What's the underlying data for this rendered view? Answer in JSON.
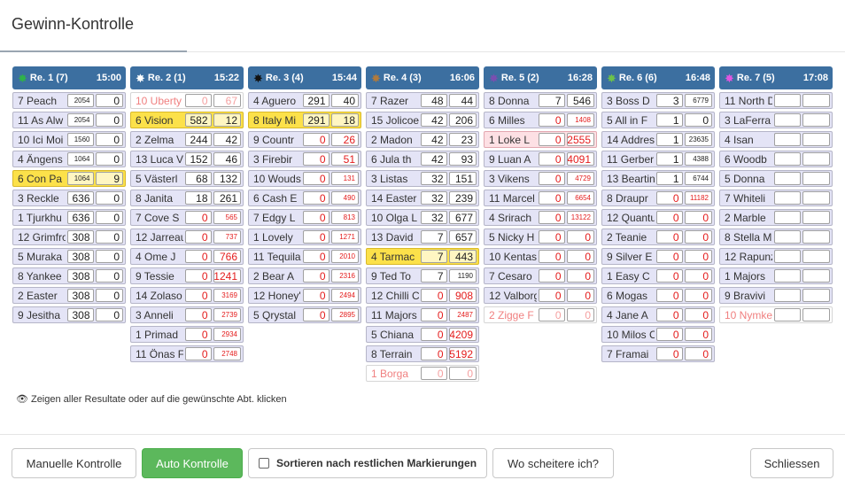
{
  "modal": {
    "title": "Gewinn-Kontrolle"
  },
  "races": [
    {
      "name": "Re. 1 (7)",
      "time": "15:00",
      "color": "#2fb24a",
      "rows": [
        {
          "name": "7 Peach",
          "a": "2054",
          "b": "0",
          "style": "n"
        },
        {
          "name": "11 As Alw",
          "a": "2054",
          "b": "0",
          "style": "n"
        },
        {
          "name": "10 Ici Moi",
          "a": "1560",
          "b": "0",
          "style": "n"
        },
        {
          "name": "4 Ängens",
          "a": "1064",
          "b": "0",
          "style": "n"
        },
        {
          "name": "6 Con Pa",
          "a": "1064",
          "b": "9",
          "style": "hl"
        },
        {
          "name": "3 Reckle",
          "a": "636",
          "b": "0",
          "style": "n"
        },
        {
          "name": "1 Tjurkhu",
          "a": "636",
          "b": "0",
          "style": "n"
        },
        {
          "name": "12 Grimfro",
          "a": "308",
          "b": "0",
          "style": "n"
        },
        {
          "name": "5 Muraka",
          "a": "308",
          "b": "0",
          "style": "n"
        },
        {
          "name": "8 Yankee",
          "a": "308",
          "b": "0",
          "style": "n"
        },
        {
          "name": "2 Easter",
          "a": "308",
          "b": "0",
          "style": "n"
        },
        {
          "name": "9 Jesitha",
          "a": "308",
          "b": "0",
          "style": "n"
        }
      ]
    },
    {
      "name": "Re. 2 (1)",
      "time": "15:22",
      "color": "#ffffff",
      "rows": [
        {
          "name": "10 Uberty",
          "a": "0",
          "b": "67",
          "style": "dim"
        },
        {
          "name": "6 Vision",
          "a": "582",
          "b": "12",
          "style": "hl"
        },
        {
          "name": "2 Zelma",
          "a": "244",
          "b": "42",
          "style": "n"
        },
        {
          "name": "13 Luca V",
          "a": "152",
          "b": "46",
          "style": "n"
        },
        {
          "name": "5 Västerl",
          "a": "68",
          "b": "132",
          "style": "n"
        },
        {
          "name": "8 Janita",
          "a": "18",
          "b": "261",
          "style": "n"
        },
        {
          "name": "7 Cove S",
          "a": "0",
          "b": "565",
          "style": "n"
        },
        {
          "name": "12 Jarreau",
          "a": "0",
          "b": "737",
          "style": "n"
        },
        {
          "name": "4 Ome J",
          "a": "0",
          "b": "766",
          "style": "n"
        },
        {
          "name": "9 Tessie",
          "a": "0",
          "b": "1241",
          "style": "n"
        },
        {
          "name": "14 Zolaso",
          "a": "0",
          "b": "3169",
          "style": "n"
        },
        {
          "name": "3 Anneli",
          "a": "0",
          "b": "2739",
          "style": "n"
        },
        {
          "name": "1 Primad",
          "a": "0",
          "b": "2934",
          "style": "n"
        },
        {
          "name": "11 Önas F",
          "a": "0",
          "b": "2748",
          "style": "n"
        }
      ]
    },
    {
      "name": "Re. 3 (4)",
      "time": "15:44",
      "color": "#111111",
      "rows": [
        {
          "name": "4 Aguero",
          "a": "291",
          "b": "40",
          "style": "n"
        },
        {
          "name": "8 Italy Mi",
          "a": "291",
          "b": "18",
          "style": "hl"
        },
        {
          "name": "9 Countr",
          "a": "0",
          "b": "26",
          "style": "n"
        },
        {
          "name": "3 Firebir",
          "a": "0",
          "b": "51",
          "style": "n"
        },
        {
          "name": "10 Wouds",
          "a": "0",
          "b": "131",
          "style": "n"
        },
        {
          "name": "6 Cash E",
          "a": "0",
          "b": "490",
          "style": "n"
        },
        {
          "name": "7 Edgy L",
          "a": "0",
          "b": "813",
          "style": "n"
        },
        {
          "name": "1 Lovely",
          "a": "0",
          "b": "1271",
          "style": "n"
        },
        {
          "name": "11 Tequila",
          "a": "0",
          "b": "2010",
          "style": "n"
        },
        {
          "name": "2 Bear A",
          "a": "0",
          "b": "2316",
          "style": "n"
        },
        {
          "name": "12 Honey'",
          "a": "0",
          "b": "2494",
          "style": "n"
        },
        {
          "name": "5 Qrystal",
          "a": "0",
          "b": "2895",
          "style": "n"
        }
      ]
    },
    {
      "name": "Re. 4 (3)",
      "time": "16:06",
      "color": "#b07a3c",
      "rows": [
        {
          "name": "7 Razer",
          "a": "48",
          "b": "44",
          "style": "n"
        },
        {
          "name": "15 Jolicoe",
          "a": "42",
          "b": "206",
          "style": "n"
        },
        {
          "name": "2 Madon",
          "a": "42",
          "b": "23",
          "style": "n"
        },
        {
          "name": "6 Jula th",
          "a": "42",
          "b": "93",
          "style": "n"
        },
        {
          "name": "3 Listas",
          "a": "32",
          "b": "151",
          "style": "n"
        },
        {
          "name": "14 Easter",
          "a": "32",
          "b": "239",
          "style": "n"
        },
        {
          "name": "10 Olga L",
          "a": "32",
          "b": "677",
          "style": "n"
        },
        {
          "name": "13 David",
          "a": "7",
          "b": "657",
          "style": "n"
        },
        {
          "name": "4 Tarmac",
          "a": "7",
          "b": "443",
          "style": "hl"
        },
        {
          "name": "9 Ted To",
          "a": "7",
          "b": "1190",
          "style": "n"
        },
        {
          "name": "12 Chilli C",
          "a": "0",
          "b": "908",
          "style": "n"
        },
        {
          "name": "11 Majors",
          "a": "0",
          "b": "2487",
          "style": "n"
        },
        {
          "name": "5 Chiana",
          "a": "0",
          "b": "4209",
          "style": "n"
        },
        {
          "name": "8 Terrain",
          "a": "0",
          "b": "5192",
          "style": "n"
        },
        {
          "name": "1 Borga",
          "a": "0",
          "b": "0",
          "style": "dim"
        }
      ]
    },
    {
      "name": "Re. 5 (2)",
      "time": "16:28",
      "color": "#7a4fb0",
      "rows": [
        {
          "name": "8 Donna",
          "a": "7",
          "b": "546",
          "style": "n"
        },
        {
          "name": "6 Milles",
          "a": "0",
          "b": "1408",
          "style": "n"
        },
        {
          "name": "1 Loke L",
          "a": "0",
          "b": "2555",
          "style": "neg"
        },
        {
          "name": "9 Luan A",
          "a": "0",
          "b": "4091",
          "style": "n"
        },
        {
          "name": "3 Vikens",
          "a": "0",
          "b": "4729",
          "style": "n"
        },
        {
          "name": "11 Marcel",
          "a": "0",
          "b": "6654",
          "style": "n"
        },
        {
          "name": "4 Srirach",
          "a": "0",
          "b": "13122",
          "style": "n"
        },
        {
          "name": "5 Nicky H",
          "a": "0",
          "b": "0",
          "style": "n"
        },
        {
          "name": "10 Kentas",
          "a": "0",
          "b": "0",
          "style": "n"
        },
        {
          "name": "7 Cesaro",
          "a": "0",
          "b": "0",
          "style": "n"
        },
        {
          "name": "12 Valborg",
          "a": "0",
          "b": "0",
          "style": "n"
        },
        {
          "name": "2 Zigge F",
          "a": "0",
          "b": "0",
          "style": "dim"
        }
      ]
    },
    {
      "name": "Re. 6 (6)",
      "time": "16:48",
      "color": "#6cc24a",
      "rows": [
        {
          "name": "3 Boss D",
          "a": "3",
          "b": "6779",
          "style": "n"
        },
        {
          "name": "5 All in F",
          "a": "1",
          "b": "0",
          "style": "n"
        },
        {
          "name": "14 Addres",
          "a": "1",
          "b": "23635",
          "style": "n"
        },
        {
          "name": "11 Gerber",
          "a": "1",
          "b": "4388",
          "style": "n"
        },
        {
          "name": "13 Beartin",
          "a": "1",
          "b": "6744",
          "style": "n"
        },
        {
          "name": "8 Draupr",
          "a": "0",
          "b": "11182",
          "style": "n"
        },
        {
          "name": "12 Quantu",
          "a": "0",
          "b": "0",
          "style": "n"
        },
        {
          "name": "2 Teanie",
          "a": "0",
          "b": "0",
          "style": "n"
        },
        {
          "name": "9 Silver E",
          "a": "0",
          "b": "0",
          "style": "n"
        },
        {
          "name": "1 Easy C",
          "a": "0",
          "b": "0",
          "style": "n"
        },
        {
          "name": "6 Mogas",
          "a": "0",
          "b": "0",
          "style": "n"
        },
        {
          "name": "4 Jane A",
          "a": "0",
          "b": "0",
          "style": "n"
        },
        {
          "name": "10 Milos C",
          "a": "0",
          "b": "0",
          "style": "n"
        },
        {
          "name": "7 Framai",
          "a": "0",
          "b": "0",
          "style": "n"
        }
      ]
    },
    {
      "name": "Re. 7 (5)",
      "time": "17:08",
      "color": "#e056e0",
      "rows": [
        {
          "name": "11 North D",
          "a": "",
          "b": "",
          "style": "n"
        },
        {
          "name": "3 LaFerra",
          "a": "",
          "b": "",
          "style": "n"
        },
        {
          "name": "4 Isan",
          "a": "",
          "b": "",
          "style": "n"
        },
        {
          "name": "6 Woodb",
          "a": "",
          "b": "",
          "style": "n"
        },
        {
          "name": "5 Donna",
          "a": "",
          "b": "",
          "style": "n"
        },
        {
          "name": "7 Whiteli",
          "a": "",
          "b": "",
          "style": "n"
        },
        {
          "name": "2 Marble",
          "a": "",
          "b": "",
          "style": "n"
        },
        {
          "name": "8 Stella M",
          "a": "",
          "b": "",
          "style": "n"
        },
        {
          "name": "12 Rapunz",
          "a": "",
          "b": "",
          "style": "n"
        },
        {
          "name": "1 Majors",
          "a": "",
          "b": "",
          "style": "n"
        },
        {
          "name": "9 Bravivi",
          "a": "",
          "b": "",
          "style": "n"
        },
        {
          "name": "10 Nymke",
          "a": "",
          "b": "",
          "style": "dim"
        }
      ]
    }
  ],
  "note": {
    "icon": "eye-icon",
    "text": "Zeigen aller Resultate oder auf die gewünschte Abt. klicken"
  },
  "footer": {
    "manual": "Manuelle Kontrolle",
    "auto": "Auto Kontrolle",
    "sort": "Sortieren nach restlichen Markierungen",
    "fail": "Wo scheitere ich?",
    "close": "Schliessen"
  }
}
